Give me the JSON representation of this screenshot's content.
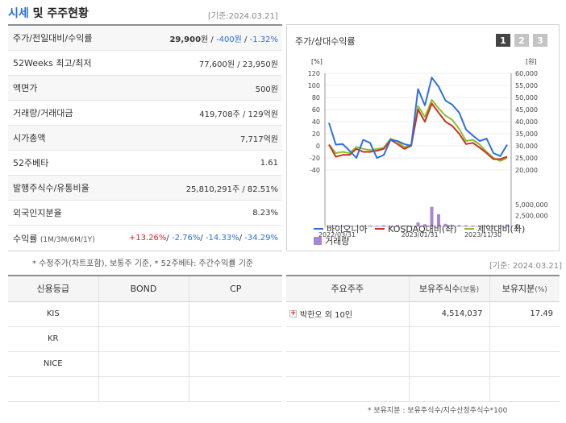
{
  "header": {
    "title_main": "시세",
    "title_rest": " 및 주주현황",
    "date": "[기준:2024.03.21]"
  },
  "quote": {
    "rows": [
      {
        "label": "주가/전일대비/수익률",
        "parts": [
          {
            "t": "29,900",
            "c": "strong"
          },
          {
            "t": "원 / ",
            "c": ""
          },
          {
            "t": "-400원",
            "c": "blue"
          },
          {
            "t": " / ",
            "c": ""
          },
          {
            "t": "-1.32%",
            "c": "blue"
          }
        ]
      },
      {
        "label": "52Weeks 최고/최저",
        "parts": [
          {
            "t": "77,600원 / 23,950원",
            "c": ""
          }
        ]
      },
      {
        "label": "액면가",
        "parts": [
          {
            "t": "500원",
            "c": ""
          }
        ]
      },
      {
        "label": "거래량/거래대금",
        "parts": [
          {
            "t": "419,708주 / 129억원",
            "c": ""
          }
        ]
      },
      {
        "label": "시가총액",
        "parts": [
          {
            "t": "7,717억원",
            "c": ""
          }
        ]
      },
      {
        "label": "52주베타",
        "parts": [
          {
            "t": "1.61",
            "c": ""
          }
        ]
      },
      {
        "label": "발행주식수/유통비율",
        "parts": [
          {
            "t": "25,810,291주 / 82.51%",
            "c": ""
          }
        ]
      },
      {
        "label": "외국인지분율",
        "parts": [
          {
            "t": "8.23%",
            "c": ""
          }
        ]
      }
    ],
    "return_label": "수익률",
    "return_sub": "(1M/3M/6M/1Y)",
    "return_parts": [
      {
        "t": "+13.26%",
        "c": "red"
      },
      {
        "t": "/ ",
        "c": ""
      },
      {
        "t": "-2.76%",
        "c": "blue"
      },
      {
        "t": "/ ",
        "c": ""
      },
      {
        "t": "-14.33%",
        "c": "blue"
      },
      {
        "t": "/ ",
        "c": ""
      },
      {
        "t": "-34.29%",
        "c": "blue"
      }
    ],
    "note": "* 수정주가(차트포함), 보통주 기준, * 52주베타: 주간수익률 기준"
  },
  "chart_panel": {
    "title": "주가/상대수익률",
    "buttons": [
      "1",
      "2",
      "3"
    ],
    "active_button": 0
  },
  "chart_data": {
    "type": "line",
    "left_unit": "[%]",
    "right_unit": "[원]",
    "left_ticks": [
      "120",
      "100",
      "80",
      "60",
      "40",
      "20",
      "0",
      "-20",
      "-40"
    ],
    "right_ticks": [
      "60,000",
      "55,000",
      "50,000",
      "45,000",
      "40,000",
      "35,000",
      "30,000",
      "25,000",
      "20,000"
    ],
    "volume_ticks": [
      "5,000,000",
      "2,500,000",
      "0"
    ],
    "x_labels": [
      "2022/03/31",
      "2023/01/31",
      "2023/11/30"
    ],
    "ylim_left": [
      -40,
      120
    ],
    "ylim_right": [
      20000,
      60000
    ],
    "volume_max": 5000000,
    "series": [
      {
        "name": "바이오니아",
        "color": "#2f6fe0",
        "values": [
          38,
          2,
          3,
          -8,
          -20,
          10,
          5,
          -20,
          -15,
          10,
          8,
          3,
          0,
          94,
          67,
          113,
          98,
          75,
          68,
          55,
          27,
          17,
          8,
          12,
          -12,
          -17,
          2
        ]
      },
      {
        "name": "KOSDAQ대비(좌)",
        "color": "#c8331f",
        "values": [
          2,
          -18,
          -15,
          -15,
          -5,
          -10,
          -10,
          -8,
          -5,
          10,
          3,
          -5,
          0,
          60,
          40,
          70,
          55,
          40,
          33,
          20,
          3,
          5,
          -3,
          -12,
          -22,
          -22,
          -18
        ]
      },
      {
        "name": "제약대비(좌)",
        "color": "#8cbe2b",
        "values": [
          2,
          -12,
          -10,
          -12,
          -2,
          -5,
          -7,
          -5,
          -3,
          12,
          7,
          -2,
          2,
          66,
          48,
          76,
          62,
          50,
          43,
          28,
          8,
          10,
          2,
          -10,
          -20,
          -25,
          -20
        ]
      }
    ],
    "volume": {
      "name": "거래량",
      "color": "#a886d6",
      "values": [
        200000,
        220000,
        180000,
        200000,
        150000,
        170000,
        200000,
        160000,
        260000,
        180000,
        300000,
        200000,
        180000,
        900000,
        500000,
        4500000,
        2800000,
        600000,
        350000,
        300000,
        250000,
        220000,
        180000,
        200000,
        160000,
        200000,
        450000
      ]
    }
  },
  "right_date": "[기준: 2024.03.21]",
  "credit": {
    "headers": [
      "신용등급",
      "BOND",
      "CP"
    ],
    "rows": [
      [
        "KIS",
        "",
        ""
      ],
      [
        "KR",
        "",
        ""
      ],
      [
        "NICE",
        "",
        ""
      ],
      [
        "",
        "",
        ""
      ]
    ]
  },
  "holders": {
    "headers": [
      "주요주주",
      "보유주식수",
      "(보통)",
      "보유지분",
      "(%)"
    ],
    "rows": [
      {
        "name": "박한오 외 10인",
        "shares": "4,514,037",
        "pct": "17.49"
      },
      {
        "name": "",
        "shares": "",
        "pct": ""
      },
      {
        "name": "",
        "shares": "",
        "pct": ""
      },
      {
        "name": "",
        "shares": "",
        "pct": ""
      }
    ],
    "note": "* 보유지분 : 보유주식수/지수산정주식수*100"
  }
}
